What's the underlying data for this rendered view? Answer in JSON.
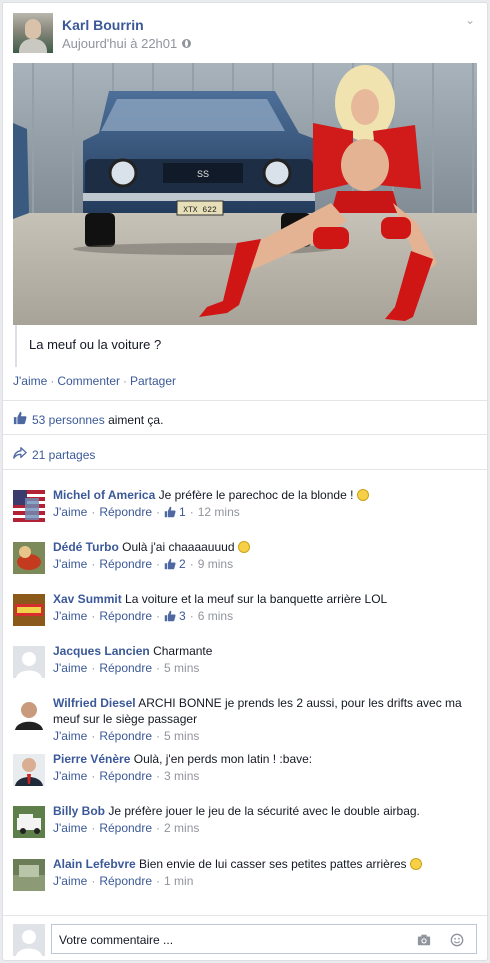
{
  "post": {
    "author": "Karl Bourrin",
    "time": "Aujourd'hui à 22h01",
    "image_plate": "XTX 622",
    "image_badge": "SS",
    "caption": "La meuf ou la voiture ?",
    "actions": {
      "like": "J'aime",
      "comment": "Commenter",
      "share": "Partager"
    },
    "likes": {
      "count": "53 personnes",
      "suffix": " aiment ça."
    },
    "shares": "21 partages"
  },
  "comment_actions": {
    "like": "J'aime",
    "reply": "Répondre"
  },
  "comments": [
    {
      "author": "Michel of America",
      "text": "Je préfère le parechoc de la blonde !",
      "emoji": true,
      "likes": "1",
      "time": "12 mins"
    },
    {
      "author": "Dédé Turbo",
      "text": "Oulà j'ai chaaaauuud",
      "emoji": true,
      "likes": "2",
      "time": "9 mins"
    },
    {
      "author": "Xav Summit",
      "text": "La voiture et la meuf sur la banquette arrière LOL",
      "emoji": false,
      "likes": "3",
      "time": "6 mins"
    },
    {
      "author": "Jacques Lancien",
      "text": "Charmante",
      "emoji": false,
      "likes": "",
      "time": "5 mins"
    },
    {
      "author": "Wilfried Diesel",
      "text": "ARCHI BONNE je prends les 2 aussi, pour les drifts avec ma meuf sur le siège passager",
      "emoji": false,
      "likes": "",
      "time": "5 mins"
    },
    {
      "author": "Pierre Vénère",
      "text": "Oulà, j'en perds mon latin ! :bave:",
      "emoji": false,
      "likes": "",
      "time": "3 mins"
    },
    {
      "author": "Billy Bob",
      "text": "Je préfère jouer le jeu de la sécurité avec le double airbag.",
      "emoji": false,
      "likes": "",
      "time": "2 mins"
    },
    {
      "author": "Alain Lefebvre",
      "text": "Bien envie de lui casser ses petites pattes arrières",
      "emoji": true,
      "likes": "",
      "time": "1 min"
    }
  ],
  "composer": {
    "placeholder": "Votre commentaire ..."
  },
  "colors": {
    "link": "#3b5998",
    "muted": "#90949c",
    "background": "#e9ebee"
  }
}
